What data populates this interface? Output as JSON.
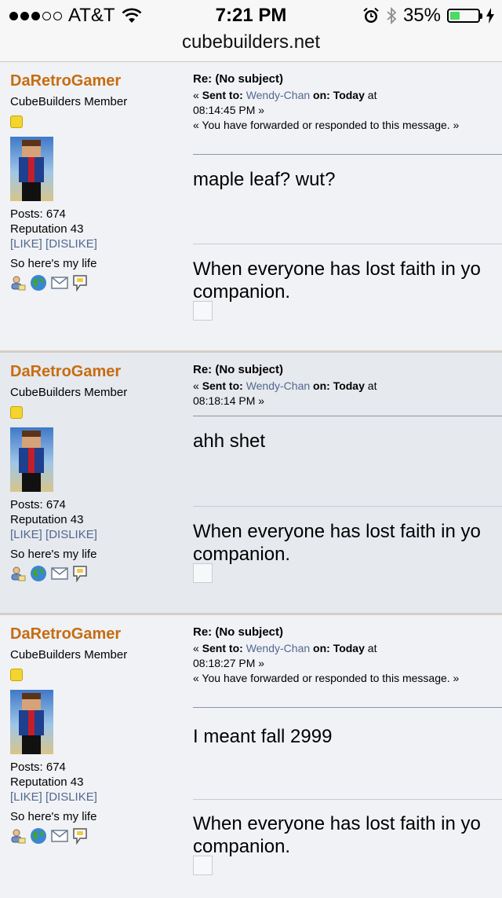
{
  "status_bar": {
    "carrier": "AT&T",
    "time": "7:21 PM",
    "battery": "35%",
    "battery_level": 0.35,
    "url": "cubebuilders.net"
  },
  "posts": [
    {
      "author": "DaRetroGamer",
      "role": "CubeBuilders Member",
      "posts": "Posts: 674",
      "reputation": "Reputation 43",
      "like": "[LIKE]",
      "dislike": "[DISLIKE]",
      "signature_short": "So here's my life",
      "subject": "Re: (No subject)",
      "sent_prefix": "« ",
      "sent_label": "Sent to:",
      "recipient": "Wendy-Chan",
      "on_label": "on:",
      "date": "Today",
      "at": "at",
      "time": "08:14:45 PM »",
      "forward_note": "« You have forwarded or responded to this message. »",
      "message": "maple leaf? wut?",
      "signature_line1": "When everyone has lost faith in yo",
      "signature_line2": "companion."
    },
    {
      "author": "DaRetroGamer",
      "role": "CubeBuilders Member",
      "posts": "Posts: 674",
      "reputation": "Reputation 43",
      "like": "[LIKE]",
      "dislike": "[DISLIKE]",
      "signature_short": "So here's my life",
      "subject": "Re: (No subject)",
      "sent_prefix": "« ",
      "sent_label": "Sent to:",
      "recipient": "Wendy-Chan",
      "on_label": "on:",
      "date": "Today",
      "at": "at",
      "time": "08:18:14 PM »",
      "forward_note": "",
      "message": "ahh shet",
      "signature_line1": "When everyone has lost faith in yo",
      "signature_line2": "companion."
    },
    {
      "author": "DaRetroGamer",
      "role": "CubeBuilders Member",
      "posts": "Posts: 674",
      "reputation": "Reputation 43",
      "like": "[LIKE]",
      "dislike": "[DISLIKE]",
      "signature_short": "So here's my life",
      "subject": "Re: (No subject)",
      "sent_prefix": "« ",
      "sent_label": "Sent to:",
      "recipient": "Wendy-Chan",
      "on_label": "on:",
      "date": "Today",
      "at": "at",
      "time": "08:18:27 PM »",
      "forward_note": "« You have forwarded or responded to this message. »",
      "message": "I meant fall 2999",
      "signature_line1": "When everyone has lost faith in yo",
      "signature_line2": "companion."
    }
  ],
  "icons": [
    "profile-icon",
    "website-globe-icon",
    "email-icon",
    "personal-message-icon"
  ],
  "colors": {
    "author_name": "#c76c10",
    "link": "#52688e",
    "alt_background": "#e6e9ee",
    "background": "#f0f2f5",
    "battery_fill": "#4cd964"
  }
}
